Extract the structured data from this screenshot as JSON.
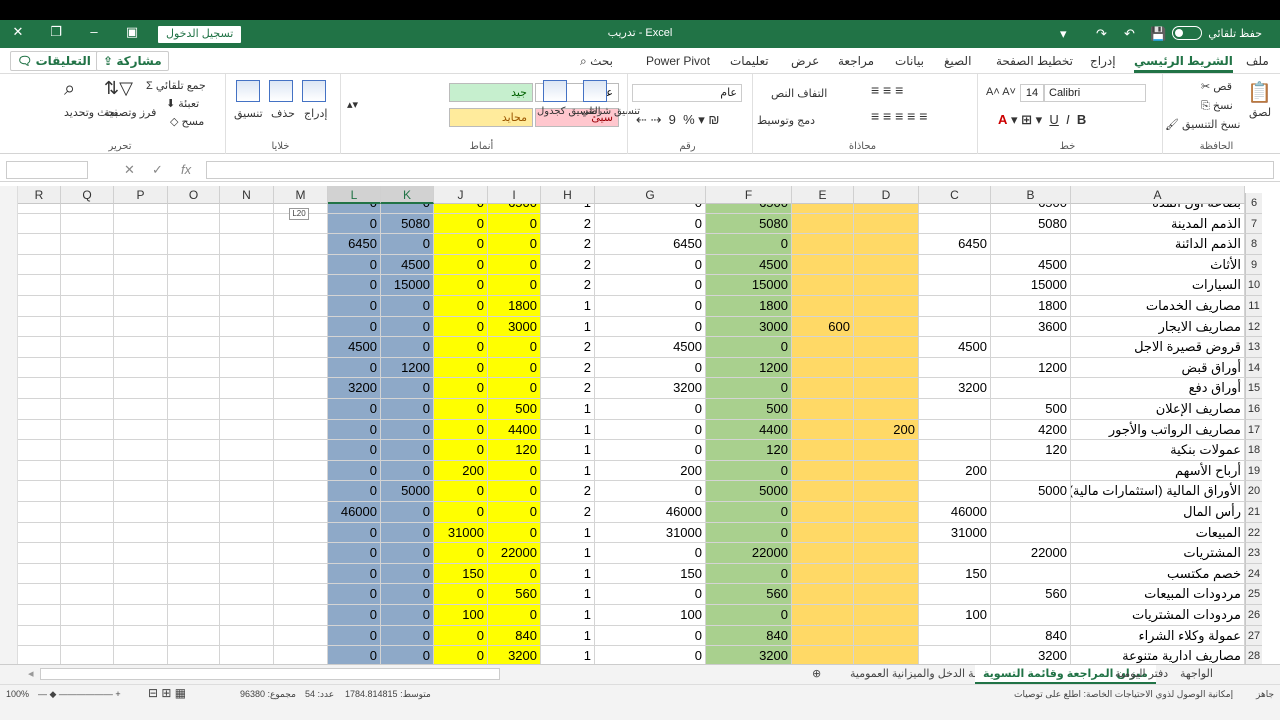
{
  "titlebar": {
    "doc_title": "تدريب - Excel",
    "signin": "تسجيل الدخول",
    "autosave": "حفظ تلقائي"
  },
  "tabs": {
    "file": "ملف",
    "home": "الشريط الرئيسي",
    "insert": "إدراج",
    "layout": "تخطيط الصفحة",
    "formulas": "الصيغ",
    "data": "بيانات",
    "review": "مراجعة",
    "view": "عرض",
    "help": "تعليمات",
    "powerpivot": "Power Pivot",
    "search": "بحث",
    "share": "مشاركة",
    "comments": "التعليقات"
  },
  "ribbon": {
    "clipboard": {
      "label": "الحافظة",
      "paste": "لصق",
      "cut": "قص",
      "copy": "نسخ",
      "format_painter": "نسخ التنسيق"
    },
    "font": {
      "label": "خط",
      "name": "Calibri",
      "size": "14"
    },
    "alignment": {
      "label": "محاذاة",
      "wrap": "التفاف النص",
      "merge": "دمج وتوسيط"
    },
    "number": {
      "label": "رقم",
      "format": "عام"
    },
    "styles": {
      "label": "أنماط",
      "conditional": "تنسيق شرطي",
      "as_table": "التنسيق كجدول",
      "normal": "عادي",
      "bad": "سيئ",
      "good": "جيد",
      "neutral": "محايد"
    },
    "cells": {
      "label": "خلايا",
      "insert": "إدراج",
      "delete": "حذف",
      "format": "تنسيق"
    },
    "editing": {
      "label": "تحرير",
      "autosum": "جمع تلقائي",
      "fill": "تعبئة",
      "clear": "مسح",
      "sort": "فرز وتصفية",
      "find": "بحث وتحديد"
    }
  },
  "formula_bar": {
    "name_box": "",
    "fx": "fx",
    "content": ""
  },
  "tooltip": "L20",
  "columns": [
    "A",
    "B",
    "C",
    "D",
    "E",
    "F",
    "G",
    "H",
    "I",
    "J",
    "K",
    "L",
    "M",
    "N",
    "O",
    "P",
    "Q",
    "R"
  ],
  "rows": [
    {
      "n": "6",
      "A": "بضاعة أول المدة",
      "B": "6500",
      "C": "",
      "D": "",
      "E": "",
      "F": "6500",
      "G": "0",
      "H": "1",
      "I": "6500",
      "J": "0",
      "K": "0",
      "L": "0"
    },
    {
      "n": "7",
      "A": "الذمم المدينة",
      "B": "5080",
      "C": "",
      "D": "",
      "E": "",
      "F": "5080",
      "G": "0",
      "H": "2",
      "I": "0",
      "J": "0",
      "K": "5080",
      "L": "0"
    },
    {
      "n": "8",
      "A": "الذمم الدائنة",
      "B": "",
      "C": "6450",
      "D": "",
      "E": "",
      "F": "0",
      "G": "6450",
      "H": "2",
      "I": "0",
      "J": "0",
      "K": "0",
      "L": "6450"
    },
    {
      "n": "9",
      "A": "الأثاث",
      "B": "4500",
      "C": "",
      "D": "",
      "E": "",
      "F": "4500",
      "G": "0",
      "H": "2",
      "I": "0",
      "J": "0",
      "K": "4500",
      "L": "0"
    },
    {
      "n": "10",
      "A": "السيارات",
      "B": "15000",
      "C": "",
      "D": "",
      "E": "",
      "F": "15000",
      "G": "0",
      "H": "2",
      "I": "0",
      "J": "0",
      "K": "15000",
      "L": "0"
    },
    {
      "n": "11",
      "A": "مصاريف الخدمات",
      "B": "1800",
      "C": "",
      "D": "",
      "E": "",
      "F": "1800",
      "G": "0",
      "H": "1",
      "I": "1800",
      "J": "0",
      "K": "0",
      "L": "0"
    },
    {
      "n": "12",
      "A": "مصاريف الايجار",
      "B": "3600",
      "C": "",
      "D": "",
      "E": "600",
      "F": "3000",
      "G": "0",
      "H": "1",
      "I": "3000",
      "J": "0",
      "K": "0",
      "L": "0"
    },
    {
      "n": "13",
      "A": "قروض قصيرة الاجل",
      "B": "",
      "C": "4500",
      "D": "",
      "E": "",
      "F": "0",
      "G": "4500",
      "H": "2",
      "I": "0",
      "J": "0",
      "K": "0",
      "L": "4500"
    },
    {
      "n": "14",
      "A": "أوراق قبض",
      "B": "1200",
      "C": "",
      "D": "",
      "E": "",
      "F": "1200",
      "G": "0",
      "H": "2",
      "I": "0",
      "J": "0",
      "K": "1200",
      "L": "0"
    },
    {
      "n": "15",
      "A": "أوراق دفع",
      "B": "",
      "C": "3200",
      "D": "",
      "E": "",
      "F": "0",
      "G": "3200",
      "H": "2",
      "I": "0",
      "J": "0",
      "K": "0",
      "L": "3200"
    },
    {
      "n": "16",
      "A": "مصاريف الإعلان",
      "B": "500",
      "C": "",
      "D": "",
      "E": "",
      "F": "500",
      "G": "0",
      "H": "1",
      "I": "500",
      "J": "0",
      "K": "0",
      "L": "0"
    },
    {
      "n": "17",
      "A": "مصاريف الرواتب والأجور",
      "B": "4200",
      "C": "",
      "D": "200",
      "E": "",
      "F": "4400",
      "G": "0",
      "H": "1",
      "I": "4400",
      "J": "0",
      "K": "0",
      "L": "0"
    },
    {
      "n": "18",
      "A": "عمولات بنكية",
      "B": "120",
      "C": "",
      "D": "",
      "E": "",
      "F": "120",
      "G": "0",
      "H": "1",
      "I": "120",
      "J": "0",
      "K": "0",
      "L": "0"
    },
    {
      "n": "19",
      "A": "أرباح الأسهم",
      "B": "",
      "C": "200",
      "D": "",
      "E": "",
      "F": "0",
      "G": "200",
      "H": "1",
      "I": "0",
      "J": "200",
      "K": "0",
      "L": "0"
    },
    {
      "n": "20",
      "A": "الأوراق المالية (استثمارات مالية)",
      "B": "5000",
      "C": "",
      "D": "",
      "E": "",
      "F": "5000",
      "G": "0",
      "H": "2",
      "I": "0",
      "J": "0",
      "K": "5000",
      "L": "0"
    },
    {
      "n": "21",
      "A": "رأس المال",
      "B": "",
      "C": "46000",
      "D": "",
      "E": "",
      "F": "0",
      "G": "46000",
      "H": "2",
      "I": "0",
      "J": "0",
      "K": "0",
      "L": "46000"
    },
    {
      "n": "22",
      "A": "المبيعات",
      "B": "",
      "C": "31000",
      "D": "",
      "E": "",
      "F": "0",
      "G": "31000",
      "H": "1",
      "I": "0",
      "J": "31000",
      "K": "0",
      "L": "0"
    },
    {
      "n": "23",
      "A": "المشتريات",
      "B": "22000",
      "C": "",
      "D": "",
      "E": "",
      "F": "22000",
      "G": "0",
      "H": "1",
      "I": "22000",
      "J": "0",
      "K": "0",
      "L": "0"
    },
    {
      "n": "24",
      "A": "خصم مكتسب",
      "B": "",
      "C": "150",
      "D": "",
      "E": "",
      "F": "0",
      "G": "150",
      "H": "1",
      "I": "0",
      "J": "150",
      "K": "0",
      "L": "0"
    },
    {
      "n": "25",
      "A": "مردودات المبيعات",
      "B": "560",
      "C": "",
      "D": "",
      "E": "",
      "F": "560",
      "G": "0",
      "H": "1",
      "I": "560",
      "J": "0",
      "K": "0",
      "L": "0"
    },
    {
      "n": "26",
      "A": "مردودات المشتريات",
      "B": "",
      "C": "100",
      "D": "",
      "E": "",
      "F": "0",
      "G": "100",
      "H": "1",
      "I": "0",
      "J": "100",
      "K": "0",
      "L": "0"
    },
    {
      "n": "27",
      "A": "عمولة وكلاء الشراء",
      "B": "840",
      "C": "",
      "D": "",
      "E": "",
      "F": "840",
      "G": "0",
      "H": "1",
      "I": "840",
      "J": "0",
      "K": "0",
      "L": "0"
    },
    {
      "n": "28",
      "A": "مصاريف ادارية متنوعة",
      "B": "3200",
      "C": "",
      "D": "",
      "E": "",
      "F": "3200",
      "G": "0",
      "H": "1",
      "I": "3200",
      "J": "0",
      "K": "0",
      "L": "0"
    }
  ],
  "sheets": [
    "الواجهة",
    "دفتر اليومية",
    "ميزان المراجعة وقائمة التسوية",
    "قائمة الدخل والميزانية العمومية"
  ],
  "status": {
    "ready": "جاهز",
    "accessibility": "إمكانية الوصول لذوي الاحتياجات الخاصة: اطلع على توصيات",
    "average": "متوسط: 1784.814815",
    "count": "عدد: 54",
    "sum": "مجموع: 96380",
    "zoom": "100%"
  },
  "colors": {
    "excel_green": "#217346",
    "col_F": "#a9d08e",
    "col_DE": "#ffd966",
    "col_IJ": "#ffff00",
    "col_KL": "#8ea9c8"
  }
}
